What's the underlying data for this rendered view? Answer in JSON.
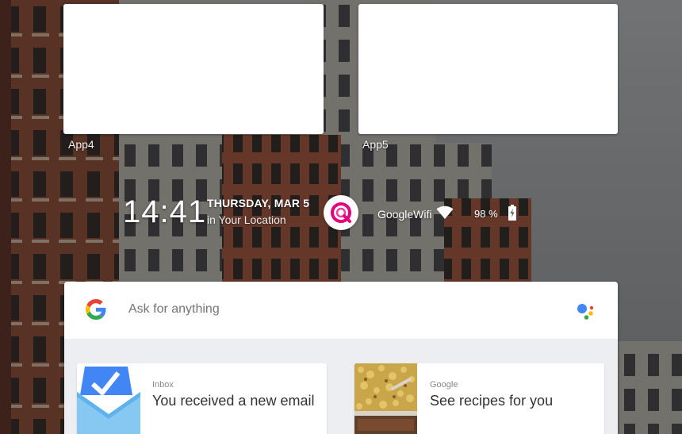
{
  "apps": [
    {
      "label": "App4"
    },
    {
      "label": "App5"
    }
  ],
  "clock": {
    "time": "14:41",
    "date": "THURSDAY, MAR 5",
    "location": "in Your Location"
  },
  "status": {
    "wifi_name": "GoogleWifi",
    "battery": "98 %",
    "icons": [
      "q-app-icon",
      "wifi-icon",
      "battery-charging-icon"
    ]
  },
  "search": {
    "placeholder": "Ask for anything",
    "icons": [
      "google-g-icon",
      "assistant-icon"
    ]
  },
  "feed": [
    {
      "source": "Inbox",
      "title": "You received a new email",
      "icon": "inbox-envelope-icon"
    },
    {
      "source": "Google",
      "title": "See recipes for you",
      "icon": "food-thumbnail"
    }
  ],
  "colors": {
    "google_blue": "#4285F4",
    "google_red": "#EA4335",
    "google_yellow": "#FBBC05",
    "google_green": "#34A853",
    "q_pink": "#E6007E",
    "card_bg": "#ECEEF1"
  }
}
